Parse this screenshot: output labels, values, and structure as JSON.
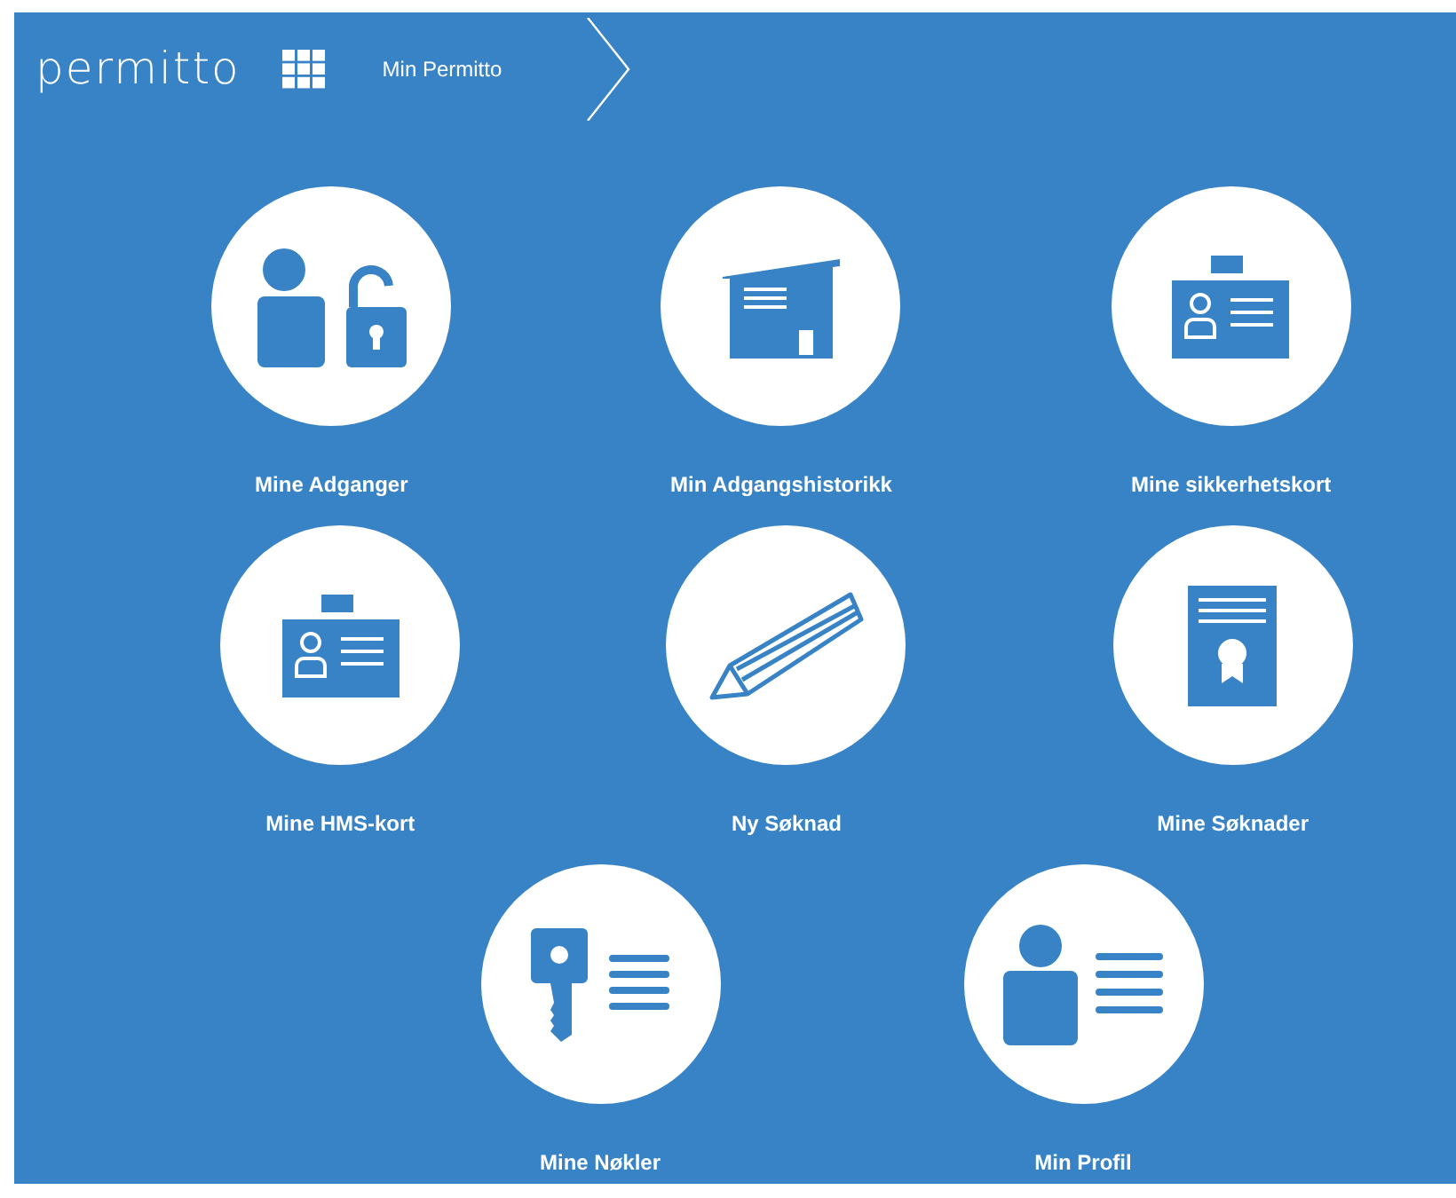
{
  "header": {
    "logo": "permitto",
    "breadcrumb": "Min Permitto"
  },
  "rows": [
    {
      "items": [
        {
          "label": "Mine Adganger",
          "kind": "access"
        },
        {
          "label": "Min Adgangshistorikk",
          "kind": "building"
        },
        {
          "label": "Mine sikkerhetskort",
          "kind": "badge"
        }
      ]
    },
    {
      "items": [
        {
          "label": "Mine HMS-kort",
          "kind": "badge"
        },
        {
          "label": "Ny Søknad",
          "kind": "pencil"
        },
        {
          "label": "Mine Søknader",
          "kind": "certificate"
        }
      ]
    },
    {
      "items": [
        {
          "label": "Mine Nøkler",
          "kind": "key"
        },
        {
          "label": "Min Profil",
          "kind": "profile"
        }
      ]
    }
  ]
}
